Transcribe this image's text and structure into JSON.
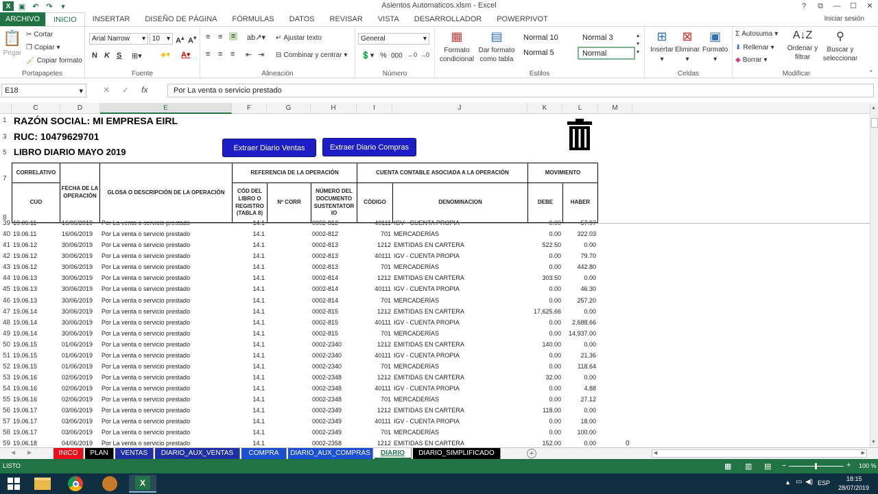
{
  "window": {
    "title": "Asientos Automaticos.xlsm - Excel",
    "help": "?",
    "restore": "⧉",
    "minimize": "—",
    "maximize": "☐",
    "close": "✕"
  },
  "ribbon_tabs": [
    "ARCHIVO",
    "INICIO",
    "INSERTAR",
    "DISEÑO DE PÁGINA",
    "FÓRMULAS",
    "DATOS",
    "REVISAR",
    "VISTA",
    "DESARROLLADOR",
    "POWERPIVOT"
  ],
  "signin": "Iniciar sesión",
  "clipboard": {
    "paste": "Pegar",
    "cut": "Cortar",
    "copy": "Copiar",
    "format_painter": "Copiar formato",
    "label": "Portapapeles"
  },
  "font": {
    "name": "Arial Narrow",
    "size": "10",
    "bold": "N",
    "italic": "K",
    "underline": "S",
    "label": "Fuente"
  },
  "alignment": {
    "wrap": "Ajustar texto",
    "merge": "Combinar y centrar",
    "label": "Alineación"
  },
  "number": {
    "format": "General",
    "percent": "%",
    "thousands": "000",
    "label": "Número"
  },
  "styles": {
    "conditional": "Formato condicional",
    "as_table": "Dar formato como tabla",
    "s1": "Normal 10",
    "s2": "Normal 3",
    "s3": "Normal 5",
    "s4": "Normal",
    "label": "Estilos"
  },
  "cells": {
    "insert": "Insertar",
    "delete": "Eliminar",
    "format": "Formato",
    "label": "Celdas"
  },
  "editing": {
    "autosum": "Autosuma",
    "fill": "Rellenar",
    "clear": "Borrar",
    "sort": "Ordenar y filtrar",
    "find": "Buscar y seleccionar",
    "label": "Modificar"
  },
  "formula_bar": {
    "name_box": "E18",
    "content": "Por La venta o servicio prestado"
  },
  "columns": [
    "C",
    "D",
    "E",
    "F",
    "G",
    "H",
    "I",
    "J",
    "K",
    "L",
    "M"
  ],
  "report": {
    "company": "RAZÓN SOCIAL: MI EMPRESA EIRL",
    "ruc": "RUC: 10479629701",
    "book": "LIBRO DIARIO MAYO 2019",
    "btn_ventas": "Extraer Diario Ventas",
    "btn_compras": "Extraer Diario Compras"
  },
  "table_headers": {
    "correlativo": "CORRELATIVO",
    "cuo": "CUO",
    "fecha": "FECHA DE LA OPERACIÓN",
    "glosa": "GLOSA O DESCRIPCIÓN DE LA OPERACIÓN",
    "referencia": "REFERENCIA DE LA OPERACIÓN",
    "cod_libro": "CÓD DEL LIBRO O REGISTRO (TABLA 8)",
    "ncorr": "Nº CORR",
    "num_doc": "NÚMERO DEL DOCUMENTO SUSTENTATOR IO",
    "cuenta": "CUENTA CONTABLE ASOCIADA A LA OPERACIÓN",
    "codigo": "CÓDIGO",
    "denominacion": "DENOMINACION",
    "movimiento": "MOVIMIENTO",
    "debe": "DEBE",
    "haber": "HABER"
  },
  "header_rows": [
    "1",
    "3",
    "5",
    "7",
    "8"
  ],
  "rows": [
    {
      "r": "39",
      "cuo": "19.06.11",
      "fecha": "16/06/2019",
      "glosa": "Por La venta o servicio prestado",
      "lib": "14.1",
      "doc": "0002-812",
      "cod": "40111",
      "den": "IGV - CUENTA PROPIA",
      "debe": "0.00",
      "haber": "57.97"
    },
    {
      "r": "40",
      "cuo": "19.06.11",
      "fecha": "16/06/2019",
      "glosa": "Por La venta o servicio prestado",
      "lib": "14.1",
      "doc": "0002-812",
      "cod": "701",
      "den": "MERCADERÍAS",
      "debe": "0.00",
      "haber": "322.03"
    },
    {
      "r": "41",
      "cuo": "19.06.12",
      "fecha": "30/06/2019",
      "glosa": "Por La venta o servicio prestado",
      "lib": "14.1",
      "doc": "0002-813",
      "cod": "1212",
      "den": "EMITIDAS EN CARTERA",
      "debe": "522.50",
      "haber": "0.00"
    },
    {
      "r": "42",
      "cuo": "19.06.12",
      "fecha": "30/06/2019",
      "glosa": "Por La venta o servicio prestado",
      "lib": "14.1",
      "doc": "0002-813",
      "cod": "40111",
      "den": "IGV - CUENTA PROPIA",
      "debe": "0.00",
      "haber": "79.70"
    },
    {
      "r": "43",
      "cuo": "19.06.12",
      "fecha": "30/06/2019",
      "glosa": "Por La venta o servicio prestado",
      "lib": "14.1",
      "doc": "0002-813",
      "cod": "701",
      "den": "MERCADERÍAS",
      "debe": "0.00",
      "haber": "442.80"
    },
    {
      "r": "44",
      "cuo": "19.06.13",
      "fecha": "30/06/2019",
      "glosa": "Por La venta o servicio prestado",
      "lib": "14.1",
      "doc": "0002-814",
      "cod": "1212",
      "den": "EMITIDAS EN CARTERA",
      "debe": "303.50",
      "haber": "0.00"
    },
    {
      "r": "45",
      "cuo": "19.06.13",
      "fecha": "30/06/2019",
      "glosa": "Por La venta o servicio prestado",
      "lib": "14.1",
      "doc": "0002-814",
      "cod": "40111",
      "den": "IGV - CUENTA PROPIA",
      "debe": "0.00",
      "haber": "46.30"
    },
    {
      "r": "46",
      "cuo": "19.06.13",
      "fecha": "30/06/2019",
      "glosa": "Por La venta o servicio prestado",
      "lib": "14.1",
      "doc": "0002-814",
      "cod": "701",
      "den": "MERCADERÍAS",
      "debe": "0.00",
      "haber": "257.20"
    },
    {
      "r": "47",
      "cuo": "19.06.14",
      "fecha": "30/06/2019",
      "glosa": "Por La venta o servicio prestado",
      "lib": "14.1",
      "doc": "0002-815",
      "cod": "1212",
      "den": "EMITIDAS EN CARTERA",
      "debe": "17,625.66",
      "haber": "0.00"
    },
    {
      "r": "48",
      "cuo": "19.06.14",
      "fecha": "30/06/2019",
      "glosa": "Por La venta o servicio prestado",
      "lib": "14.1",
      "doc": "0002-815",
      "cod": "40111",
      "den": "IGV - CUENTA PROPIA",
      "debe": "0.00",
      "haber": "2,688.66"
    },
    {
      "r": "49",
      "cuo": "19.06.14",
      "fecha": "30/06/2019",
      "glosa": "Por La venta o servicio prestado",
      "lib": "14.1",
      "doc": "0002-815",
      "cod": "701",
      "den": "MERCADERÍAS",
      "debe": "0.00",
      "haber": "14,937.00"
    },
    {
      "r": "50",
      "cuo": "19.06.15",
      "fecha": "01/06/2019",
      "glosa": "Por La venta o servicio prestado",
      "lib": "14.1",
      "doc": "0002-2340",
      "cod": "1212",
      "den": "EMITIDAS EN CARTERA",
      "debe": "140.00",
      "haber": "0.00"
    },
    {
      "r": "51",
      "cuo": "19.06.15",
      "fecha": "01/06/2019",
      "glosa": "Por La venta o servicio prestado",
      "lib": "14.1",
      "doc": "0002-2340",
      "cod": "40111",
      "den": "IGV - CUENTA PROPIA",
      "debe": "0.00",
      "haber": "21.36"
    },
    {
      "r": "52",
      "cuo": "19.06.15",
      "fecha": "01/06/2019",
      "glosa": "Por La venta o servicio prestado",
      "lib": "14.1",
      "doc": "0002-2340",
      "cod": "701",
      "den": "MERCADERÍAS",
      "debe": "0.00",
      "haber": "118.64"
    },
    {
      "r": "53",
      "cuo": "19.06.16",
      "fecha": "02/06/2019",
      "glosa": "Por La venta o servicio prestado",
      "lib": "14.1",
      "doc": "0002-2348",
      "cod": "1212",
      "den": "EMITIDAS EN CARTERA",
      "debe": "32.00",
      "haber": "0.00"
    },
    {
      "r": "54",
      "cuo": "19.06.16",
      "fecha": "02/06/2019",
      "glosa": "Por La venta o servicio prestado",
      "lib": "14.1",
      "doc": "0002-2348",
      "cod": "40111",
      "den": "IGV - CUENTA PROPIA",
      "debe": "0.00",
      "haber": "4.88"
    },
    {
      "r": "55",
      "cuo": "19.06.16",
      "fecha": "02/06/2019",
      "glosa": "Por La venta o servicio prestado",
      "lib": "14.1",
      "doc": "0002-2348",
      "cod": "701",
      "den": "MERCADERÍAS",
      "debe": "0.00",
      "haber": "27.12"
    },
    {
      "r": "56",
      "cuo": "19.06.17",
      "fecha": "03/06/2019",
      "glosa": "Por La venta o servicio prestado",
      "lib": "14.1",
      "doc": "0002-2349",
      "cod": "1212",
      "den": "EMITIDAS EN CARTERA",
      "debe": "118.00",
      "haber": "0.00"
    },
    {
      "r": "57",
      "cuo": "19.06.17",
      "fecha": "03/06/2019",
      "glosa": "Por La venta o servicio prestado",
      "lib": "14.1",
      "doc": "0002-2349",
      "cod": "40111",
      "den": "IGV - CUENTA PROPIA",
      "debe": "0.00",
      "haber": "18.00"
    },
    {
      "r": "58",
      "cuo": "19.06.17",
      "fecha": "03/06/2019",
      "glosa": "Por La venta o servicio prestado",
      "lib": "14.1",
      "doc": "0002-2349",
      "cod": "701",
      "den": "MERCADERÍAS",
      "debe": "0.00",
      "haber": "100.00"
    },
    {
      "r": "59",
      "cuo": "19.06.18",
      "fecha": "04/06/2019",
      "glosa": "Por La venta o servicio prestado",
      "lib": "14.1",
      "doc": "0002-2358",
      "cod": "1212",
      "den": "EMITIDAS EN CARTERA",
      "debe": "152.00",
      "haber": "0.00"
    }
  ],
  "stray_value": "0",
  "sheet_tabs": [
    {
      "name": "INICO",
      "color": "#e8101a"
    },
    {
      "name": "PLAN",
      "color": "#000000"
    },
    {
      "name": "VENTAS",
      "color": "#1f2fa6"
    },
    {
      "name": "DIARIO_AUX_VENTAS",
      "color": "#1f2fa6"
    },
    {
      "name": "COMPRA",
      "color": "#1a4fd6"
    },
    {
      "name": "DIARIO_AUX_COMPRAS",
      "color": "#1a4fd6"
    },
    {
      "name": "DIARIO",
      "color": "#ffffff"
    },
    {
      "name": "DIARIO_SIMPLIFICADO",
      "color": "#000000"
    }
  ],
  "status": {
    "ready": "LISTO",
    "zoom": "100 %"
  },
  "taskbar": {
    "lang": "ESP",
    "time": "18:15",
    "date": "28/07/2019"
  },
  "colors": {
    "excel_green": "#217346",
    "macro_button": "#1e1ec8",
    "taskbar": "#0f2e3f"
  }
}
